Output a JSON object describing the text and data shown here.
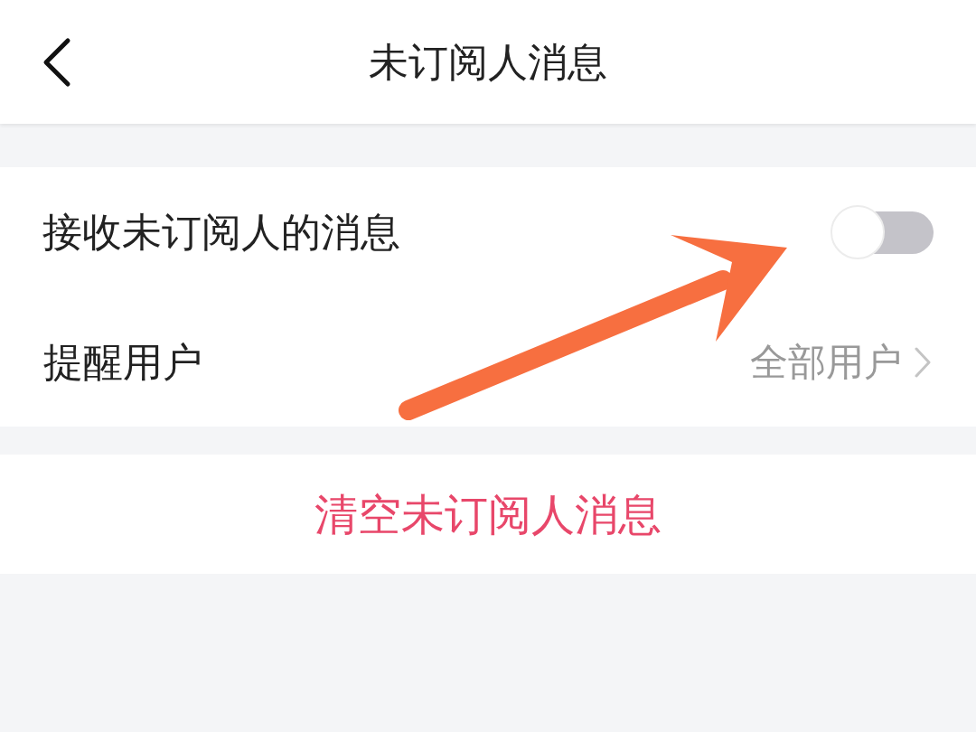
{
  "header": {
    "title": "未订阅人消息"
  },
  "settings": [
    {
      "kind": "toggle",
      "label": "接收未订阅人的消息",
      "on": false
    },
    {
      "kind": "link",
      "label": "提醒用户",
      "value": "全部用户"
    }
  ],
  "clear_button": {
    "label": "清空未订阅人消息"
  }
}
